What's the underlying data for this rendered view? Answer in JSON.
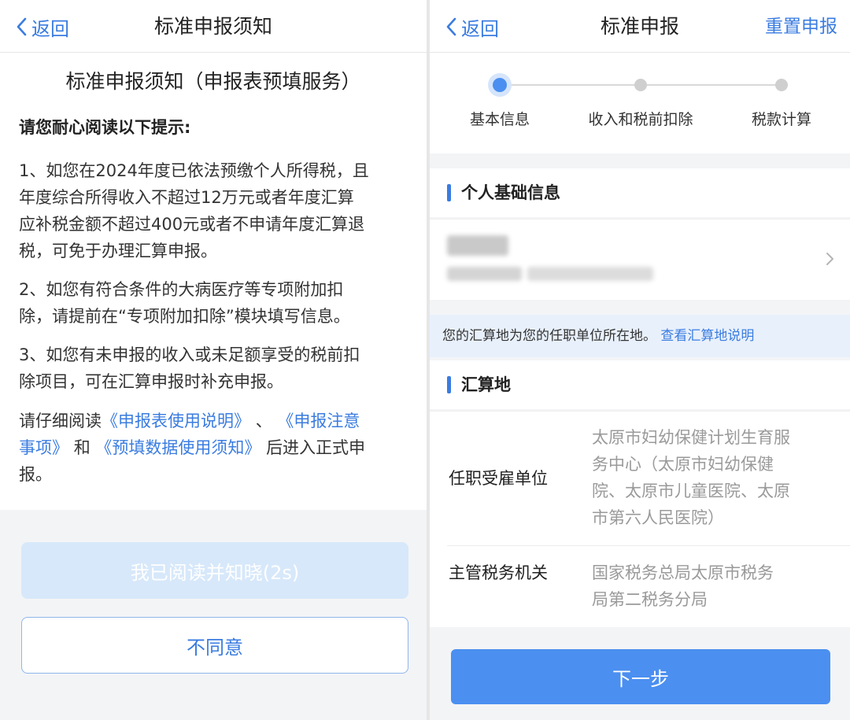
{
  "left": {
    "back_label": "返回",
    "header_title": "标准申报须知",
    "doc_title": "标准申报须知（申报表预填服务）",
    "intro": "请您耐心阅读以下提示:",
    "para1": [
      "1、如您在2024年度已依法预缴个人所得税，且",
      "年度综合所得收入不超过12万元或者年度汇算",
      "应补税金额不超过400元或者不申请年度汇算退",
      "税，可免于办理汇算申报。"
    ],
    "para2": [
      "2、如您有符合条件的大病医疗等专项附加扣",
      "除，请提前在“专项附加扣除”模块填写信息。"
    ],
    "para3": [
      "3、如您有未申报的收入或未足额享受的税前扣",
      "除项目，可在汇算申报时补充申报。"
    ],
    "para4": {
      "pre": "请仔细阅读",
      "link1": "《申报表使用说明》",
      "sep1": "、",
      "link2a": "《申报注意",
      "link2b": "事项》",
      "mid": "和",
      "link3": "《预填数据使用须知》",
      "post1": "后进入正式申",
      "post2": "报。"
    },
    "read_button": "我已阅读并知晓(2s)",
    "disagree_button": "不同意"
  },
  "right": {
    "back_label": "返回",
    "header_title": "标准申报",
    "reset_label": "重置申报",
    "steps": [
      "基本信息",
      "收入和税前扣除",
      "税款计算"
    ],
    "active_step": 0,
    "section_personal": "个人基础信息",
    "notice_text": "您的汇算地为您的任职单位所在地。",
    "notice_link": "查看汇算地说明",
    "section_settlement": "汇算地",
    "employer_label": "任职受雇单位",
    "employer_value": [
      "太原市妇幼保健计划生育服",
      "务中心（太原市妇幼保健",
      "院、太原市儿童医院、太原",
      "市第六人民医院）"
    ],
    "tax_office_label": "主管税务机关",
    "tax_office_value": [
      "国家税务总局太原市税务",
      "局第二税务分局"
    ],
    "next_button": "下一步"
  },
  "colors": {
    "accent": "#3a7ce0",
    "button_primary": "#4b8ff0",
    "button_disabled": "#d7e8fa",
    "notice_bg": "#e8f0fb"
  }
}
